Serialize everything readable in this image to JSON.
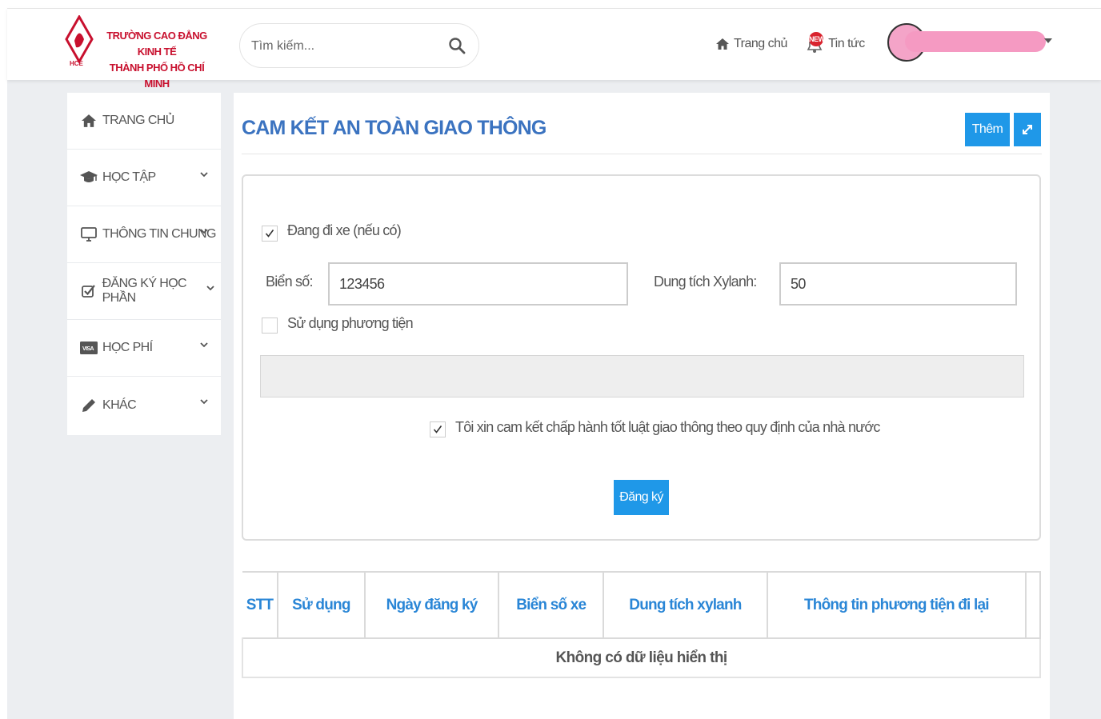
{
  "header": {
    "logo_line1": "TRƯỜNG CAO ĐẲNG KINH TẾ",
    "logo_line2": "THÀNH PHỐ HỒ CHÍ MINH",
    "logo_abbr": "HCE",
    "search_placeholder": "Tìm kiếm...",
    "nav_home": "Trang chủ",
    "nav_news": "Tin tức",
    "news_badge": "NEWS"
  },
  "sidebar": {
    "items": [
      {
        "label": "TRANG CHỦ",
        "icon": "home-icon"
      },
      {
        "label": "HỌC TẬP",
        "icon": "graduation-cap-icon"
      },
      {
        "label": "THÔNG TIN CHUNG",
        "icon": "monitor-icon"
      },
      {
        "label": "ĐĂNG KÝ HỌC PHẦN",
        "icon": "checkbox-icon"
      },
      {
        "label": "HỌC PHÍ",
        "icon": "visa-card-icon"
      },
      {
        "label": "KHÁC",
        "icon": "pencil-icon"
      }
    ]
  },
  "main": {
    "title": "CAM KẾT AN TOÀN GIAO THÔNG",
    "add_label": "Thêm",
    "form": {
      "riding_label": "Đang đi xe (nếu có)",
      "riding_checked": true,
      "plate_label": "Biển số:",
      "plate_value": "123456",
      "capacity_label": "Dung tích Xylanh:",
      "capacity_value": "50",
      "use_vehicle_label": "Sử dụng phương tiện",
      "use_vehicle_checked": false,
      "commit_label": "Tôi xin cam kết chấp hành tốt luật giao thông theo quy định của nhà nước",
      "commit_checked": true,
      "register_label": "Đăng ký"
    },
    "table": {
      "columns": [
        "STT",
        "Sử dụng",
        "Ngày đăng ký",
        "Biển số xe",
        "Dung tích xylanh",
        "Thông tin phương tiện đi lại"
      ],
      "empty_text": "Không có dữ liệu hiển thị"
    }
  },
  "colors": {
    "accent": "#1f98e8",
    "title": "#3b73c0",
    "header_text": "#2a86d6",
    "brand_red": "#c8102e"
  }
}
